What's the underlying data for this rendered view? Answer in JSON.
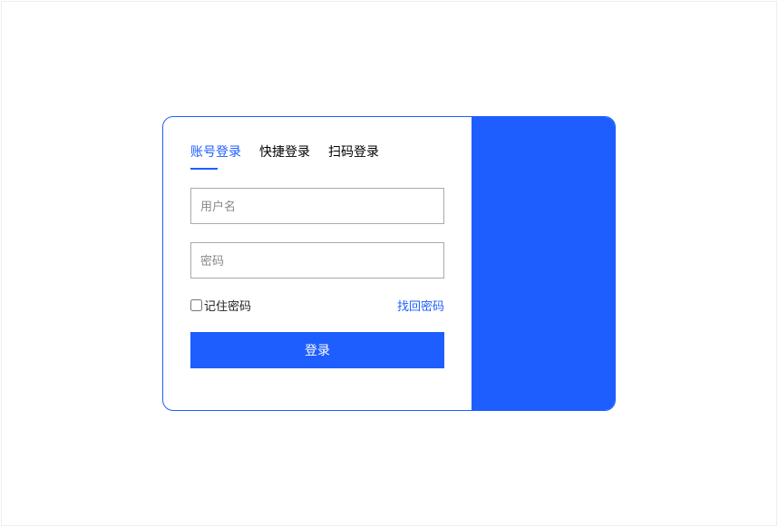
{
  "tabs": {
    "account": "账号登录",
    "quick": "快捷登录",
    "scan": "扫码登录"
  },
  "fields": {
    "username_placeholder": "用户名",
    "password_placeholder": "密码"
  },
  "options": {
    "remember_label": "记住密码",
    "forgot_label": "找回密码"
  },
  "actions": {
    "login_label": "登录"
  },
  "colors": {
    "accent": "#1E5EFF"
  }
}
